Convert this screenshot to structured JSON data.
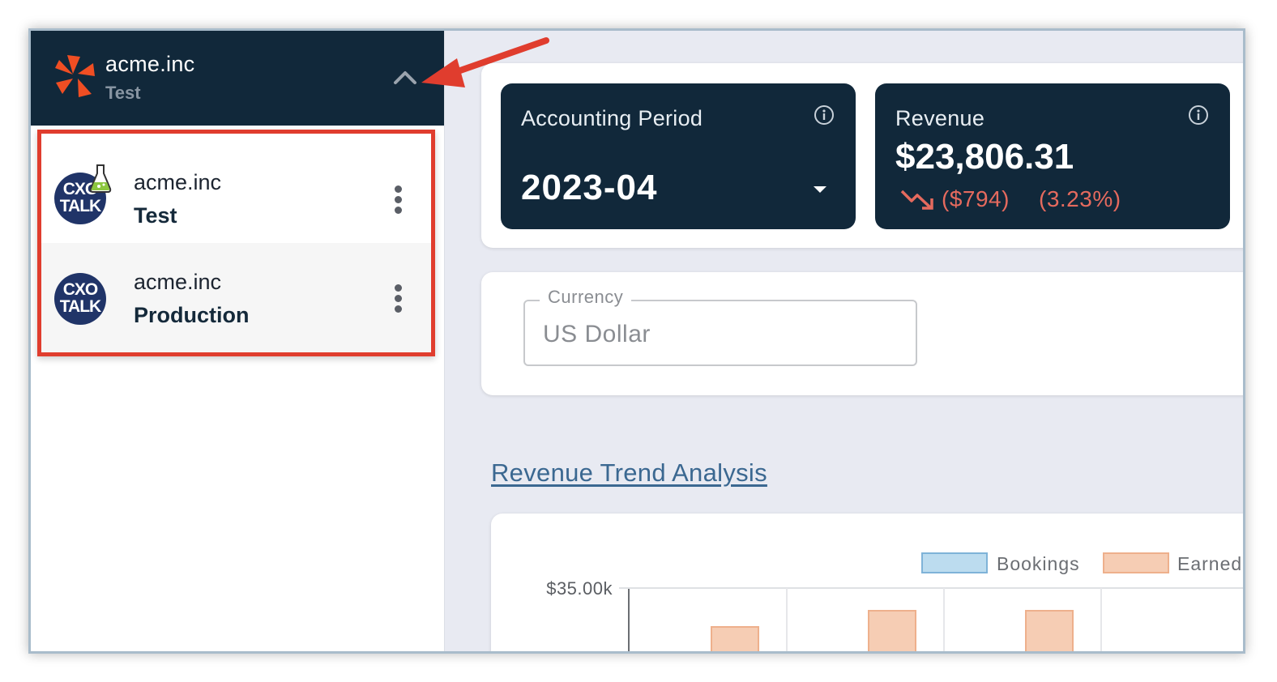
{
  "sidebar": {
    "org": {
      "name": "acme.inc",
      "env": "Test"
    },
    "workspaces": [
      {
        "name": "acme.inc",
        "env": "Test",
        "logo_l1": "CXO",
        "logo_l2": "TALK"
      },
      {
        "name": "acme.inc",
        "env": "Production",
        "logo_l1": "CXO",
        "logo_l2": "TALK"
      }
    ]
  },
  "kpis": {
    "accounting_period": {
      "title": "Accounting Period",
      "value": "2023-04"
    },
    "revenue": {
      "title": "Revenue",
      "value": "$23,806.31",
      "delta": "($794)",
      "delta_pct": "(3.23%)",
      "trend": "down"
    }
  },
  "currency": {
    "label": "Currency",
    "value": "US Dollar"
  },
  "section": {
    "title": "Revenue Trend Analysis"
  },
  "colors": {
    "navy": "#11283a",
    "accent_red": "#e03d2e",
    "negative": "#e56a5e",
    "bookings": "#bcdcef",
    "earned": "#f6cdb4",
    "link": "#3b6891"
  },
  "chart_data": {
    "type": "bar",
    "series": [
      {
        "name": "Bookings",
        "values": []
      },
      {
        "name": "Earned",
        "values": []
      }
    ],
    "legend_labels": [
      "Bookings",
      "Earned"
    ],
    "y_tick_labels": [
      "$35.00k"
    ],
    "legend": "top-right"
  }
}
